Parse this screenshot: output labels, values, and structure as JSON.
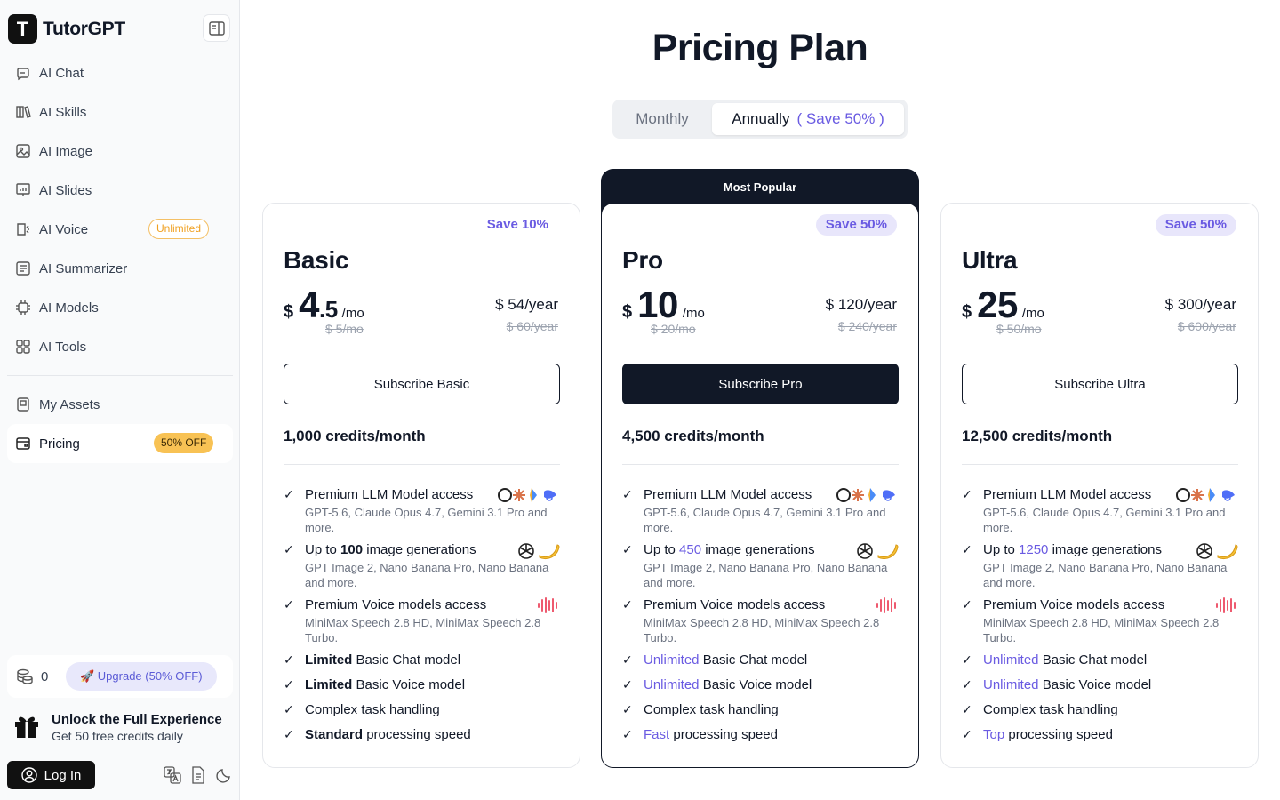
{
  "sidebar": {
    "brand": "TutorGPT",
    "brand_letter": "T",
    "items": [
      {
        "label": "AI Chat",
        "icon": "chat-icon"
      },
      {
        "label": "AI Skills",
        "icon": "books-icon"
      },
      {
        "label": "AI Image",
        "icon": "image-icon"
      },
      {
        "label": "AI Slides",
        "icon": "slides-icon"
      },
      {
        "label": "AI Voice",
        "icon": "voice-icon",
        "badge": "Unlimited"
      },
      {
        "label": "AI Summarizer",
        "icon": "summarizer-icon"
      },
      {
        "label": "AI Models",
        "icon": "models-icon"
      },
      {
        "label": "AI Tools",
        "icon": "tools-icon"
      }
    ],
    "assets_label": "My Assets",
    "pricing_label": "Pricing",
    "pricing_badge": "50% OFF",
    "credits": "0",
    "upgrade_label": "🚀 Upgrade (50% OFF)",
    "unlock_title": "Unlock the Full Experience",
    "unlock_sub": "Get 50 free credits daily",
    "login_label": "Log In"
  },
  "main": {
    "title": "Pricing Plan",
    "toggle": {
      "monthly": "Monthly",
      "annually": "Annually",
      "save": "( Save 50% )",
      "selected": "Annually"
    },
    "popular": "Most Popular"
  },
  "plans": [
    {
      "name": "Basic",
      "save": "Save 10%",
      "currency": "$",
      "price": "4",
      "price_dec": ".5",
      "per": "/mo",
      "old_mo": "$ 5/mo",
      "year": "$ 54/year",
      "old_year": "$ 60/year",
      "cta": "Subscribe Basic",
      "credits": "1,000 credits/month",
      "image_count": "100",
      "chat_level": "Limited",
      "voice_level": "Limited",
      "speed_level": "Standard"
    },
    {
      "name": "Pro",
      "save": "Save 50%",
      "currency": "$",
      "price": "10",
      "price_dec": "",
      "per": "/mo",
      "old_mo": "$ 20/mo",
      "year": "$ 120/year",
      "old_year": "$ 240/year",
      "cta": "Subscribe Pro",
      "credits": "4,500 credits/month",
      "image_count": "450",
      "chat_level": "Unlimited",
      "voice_level": "Unlimited",
      "speed_level": "Fast"
    },
    {
      "name": "Ultra",
      "save": "Save 50%",
      "currency": "$",
      "price": "25",
      "price_dec": "",
      "per": "/mo",
      "old_mo": "$ 50/mo",
      "year": "$ 300/year",
      "old_year": "$ 600/year",
      "cta": "Subscribe Ultra",
      "credits": "12,500 credits/month",
      "image_count": "1250",
      "chat_level": "Unlimited",
      "voice_level": "Unlimited",
      "speed_level": "Top"
    }
  ],
  "features": {
    "llm_title": "Premium LLM Model access",
    "llm_desc": "GPT-5.6, Claude Opus 4.7, Gemini 3.1 Pro and more.",
    "img_prefix": "Up to",
    "img_suffix": "image generations",
    "img_desc": "GPT Image 2, Nano Banana Pro, Nano Banana and more.",
    "voice_title": "Premium Voice models access",
    "voice_desc": "MiniMax Speech 2.8 HD, MiniMax Speech 2.8 Turbo.",
    "chat_suffix": "Basic Chat model",
    "voice_model_suffix": "Basic Voice model",
    "complex": "Complex task handling",
    "speed_suffix": "processing speed"
  },
  "colors": {
    "accent": "#6a5be2",
    "dark": "#111827",
    "badge_gold": "#f8c254"
  }
}
